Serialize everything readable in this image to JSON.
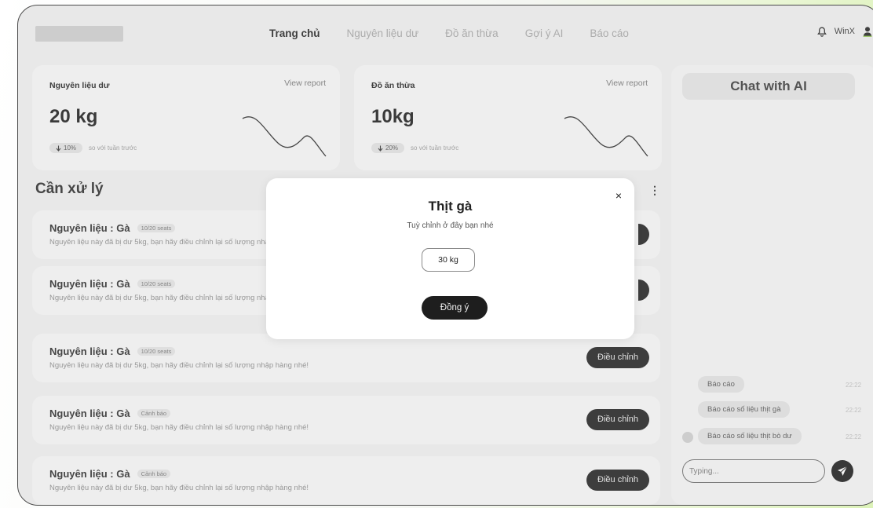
{
  "header": {
    "nav": [
      "Trang chủ",
      "Nguyên liệu dư",
      "Đồ ăn thừa",
      "Gợi ý AI",
      "Báo cáo"
    ],
    "active_nav": "Trang chủ",
    "user_name": "WinX"
  },
  "cards": [
    {
      "title": "Nguyên liệu dư",
      "link": "View report",
      "value": "20 kg",
      "change": "10%",
      "change_text": "so với tuần trước"
    },
    {
      "title": "Đồ ăn thừa",
      "link": "View report",
      "value": "10kg",
      "change": "20%",
      "change_text": "so với tuần trước"
    }
  ],
  "section": {
    "title": "Cần xử lý"
  },
  "items": [
    {
      "title": "Nguyên liệu : Gà",
      "tag": "10/20 seats",
      "desc": "Nguyên liệu này đã bị dư 5kg, bạn hãy điều chỉnh lại số lượng nhập hàng nhé!",
      "button": "Điều chỉnh"
    },
    {
      "title": "Nguyên liệu : Gà",
      "tag": "10/20 seats",
      "desc": "Nguyên liệu này đã bị dư 5kg, bạn hãy điều chỉnh lại số lượng nhập hàng nhé!",
      "button": "Điều chỉnh"
    },
    {
      "title": "Nguyên liệu : Gà",
      "tag": "10/20 seats",
      "desc": "Nguyên liệu này đã bị dư 5kg, bạn hãy điều chỉnh lại số lượng nhập hàng nhé!",
      "button": "Điều chỉnh"
    },
    {
      "title": "Nguyên liệu : Gà",
      "tag": "Cảnh báo",
      "desc": "Nguyên liệu này đã bị dư 5kg, bạn hãy điều chỉnh lại số lượng nhập hàng nhé!",
      "button": "Điều chỉnh"
    },
    {
      "title": "Nguyên liệu : Gà",
      "tag": "Cảnh báo",
      "desc": "Nguyên liệu này đã bị dư 5kg, bạn hãy điều chỉnh lại số lượng nhập hàng nhé!",
      "button": "Điều chỉnh"
    }
  ],
  "chat": {
    "title": "Chat with AI",
    "messages": [
      {
        "text": "Báo cáo",
        "time": "22:22"
      },
      {
        "text": "Báo cáo số liệu thịt gà",
        "time": "22:22"
      },
      {
        "text": "Báo cáo số liệu thịt bò dư",
        "time": "22:22"
      }
    ],
    "input_placeholder": "Typing..."
  },
  "modal": {
    "title": "Thịt gà",
    "subtitle": "Tuỳ chỉnh ở đây bạn nhé",
    "input_value": "30 kg",
    "confirm_label": "Đồng ý",
    "close_label": "×"
  },
  "colors": {
    "accent_dark": "#1f1f1f",
    "background": "#f0f0f0",
    "card": "#f7f7f7"
  },
  "icons": [
    "bell-icon",
    "user-icon",
    "arrow-down-icon",
    "kebab-menu-icon",
    "send-icon",
    "close-icon"
  ]
}
